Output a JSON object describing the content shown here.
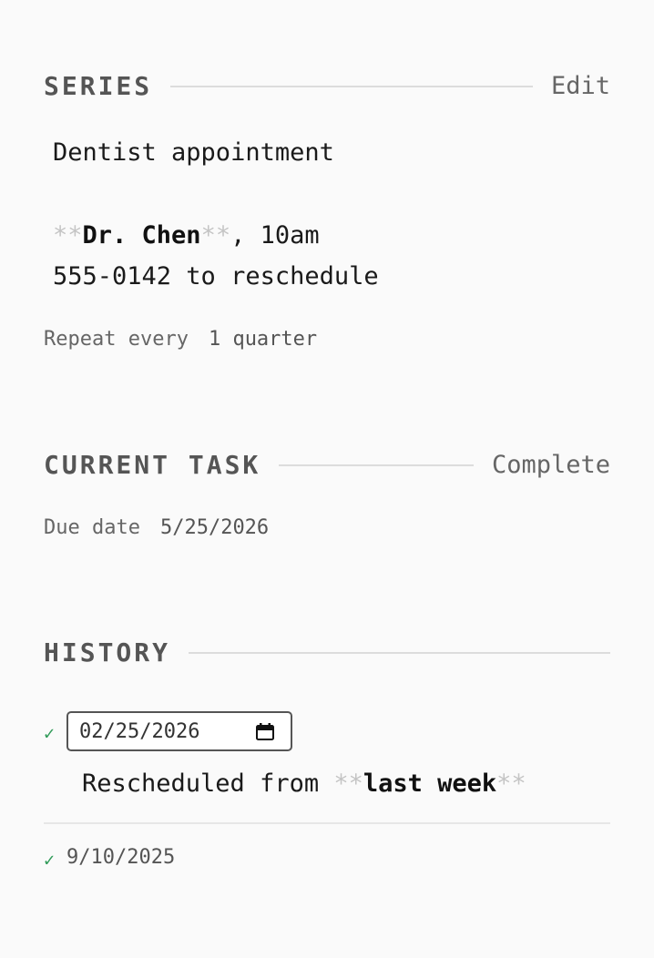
{
  "series": {
    "title": "SERIES",
    "action": "Edit",
    "note_line1": "Dentist appointment",
    "note_line2": {
      "md_open": "**",
      "bold": "Dr. Chen",
      "md_close": "**",
      "rest": ", 10am"
    },
    "note_line3": "555-0142 to reschedule",
    "repeat_label": "Repeat every",
    "repeat_value": "1 quarter"
  },
  "current_task": {
    "title": "CURRENT TASK",
    "action": "Complete",
    "due_label": "Due date",
    "due_value": "5/25/2026"
  },
  "history": {
    "title": "HISTORY",
    "entries": [
      {
        "check": "✓",
        "date_input_value": "02/25/2026",
        "note": {
          "prefix": "Rescheduled from ",
          "md_open": "**",
          "bold": "last week",
          "md_close": "**"
        }
      },
      {
        "check": "✓",
        "date": "9/10/2025"
      }
    ]
  },
  "colors": {
    "background": "#fafafa",
    "check": "#2e9a57",
    "markdown_syntax": "#c4c4c4",
    "rule": "#dcdcdc"
  },
  "icons": {
    "calendar": "calendar-icon",
    "check": "checkmark-icon"
  }
}
